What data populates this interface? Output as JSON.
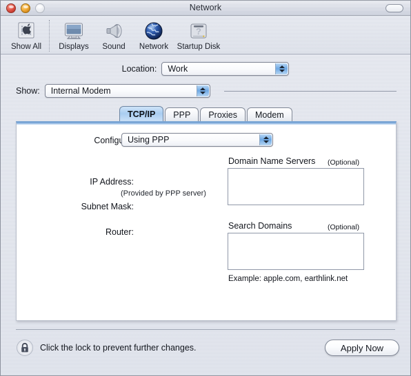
{
  "window": {
    "title": "Network",
    "controls": {
      "close": "close-button",
      "minimize": "minimize-button",
      "zoom": "zoom-button",
      "toolbar_toggle": "toolbar-toggle-button"
    }
  },
  "toolbar": {
    "items": [
      {
        "label": "Show All",
        "icon": "show-all-icon"
      },
      {
        "label": "Displays",
        "icon": "displays-icon"
      },
      {
        "label": "Sound",
        "icon": "sound-icon"
      },
      {
        "label": "Network",
        "icon": "network-globe-icon"
      },
      {
        "label": "Startup Disk",
        "icon": "startup-disk-icon"
      }
    ]
  },
  "settings": {
    "location_label": "Location:",
    "location_value": "Work",
    "show_label": "Show:",
    "show_value": "Internal Modem"
  },
  "tabs": [
    {
      "label": "TCP/IP",
      "active": true
    },
    {
      "label": "PPP",
      "active": false
    },
    {
      "label": "Proxies",
      "active": false
    },
    {
      "label": "Modem",
      "active": false
    }
  ],
  "panel": {
    "configure_label": "Configure:",
    "configure_value": "Using PPP",
    "ip_address_label": "IP Address:",
    "ip_address_note": "(Provided by PPP server)",
    "subnet_mask_label": "Subnet Mask:",
    "router_label": "Router:",
    "dns_title": "Domain Name Servers",
    "dns_optional": "(Optional)",
    "dns_value": "",
    "search_domains_title": "Search Domains",
    "search_domains_optional": "(Optional)",
    "search_domains_value": "",
    "example_text": "Example: apple.com, earthlink.net"
  },
  "footer": {
    "lock_icon": "locked-padlock-icon",
    "lock_text": "Click the lock to prevent further changes.",
    "apply_label": "Apply Now"
  },
  "colors": {
    "accent_blue": "#6ea8e4",
    "tab_active": "#a9cdf1",
    "panel_top_border": "#7aa6d6",
    "close_red": "#e2594b",
    "minimize_amber": "#f2ad3a"
  }
}
